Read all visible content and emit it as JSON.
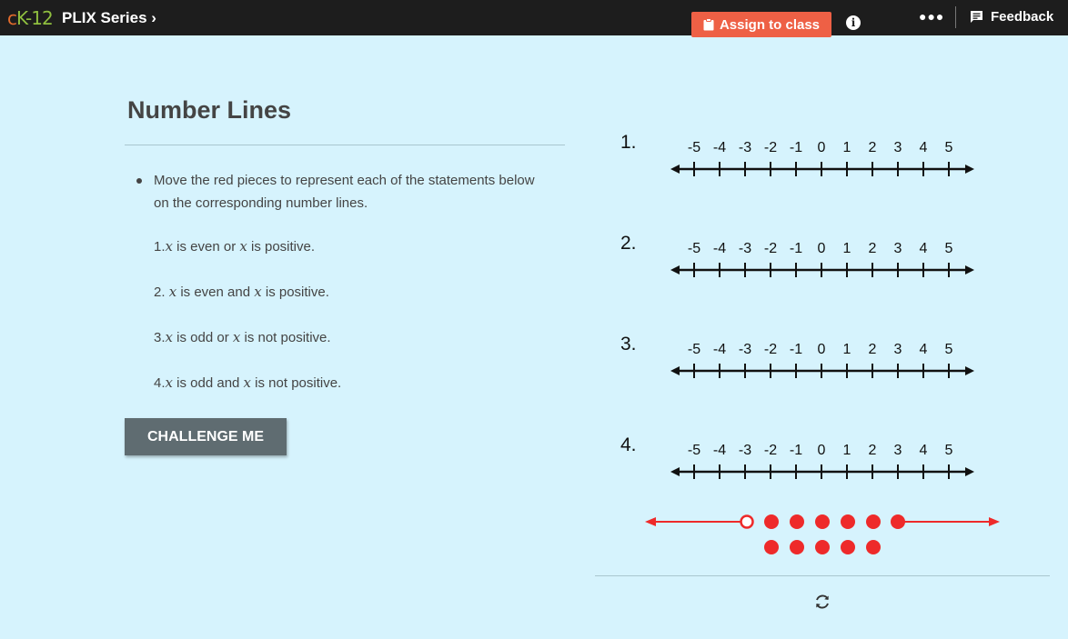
{
  "header": {
    "logo_c": "c",
    "logo_k": "K-12",
    "series": "PLIX Series",
    "series_chevron": "›",
    "assign": "Assign to class",
    "info": "i",
    "more": "●●●",
    "feedback": "Feedback"
  },
  "content": {
    "title": "Number Lines",
    "instruction": "Move the red pieces to represent each of the statements below on the corresponding number lines.",
    "statements": [
      {
        "num": "1.",
        "parts": [
          "",
          "x",
          " is even or ",
          "x",
          " is positive."
        ]
      },
      {
        "num": "2. ",
        "parts": [
          "",
          "x",
          " is even and ",
          "x",
          " is positive."
        ]
      },
      {
        "num": "3.",
        "parts": [
          "",
          "x",
          " is odd or ",
          "x",
          " is not positive."
        ]
      },
      {
        "num": "4.",
        "parts": [
          "",
          "x",
          " is odd and ",
          "x",
          " is not positive."
        ]
      }
    ],
    "challenge": "CHALLENGE ME"
  },
  "number_lines": {
    "labels": [
      "1.",
      "2.",
      "3.",
      "4."
    ],
    "ticks": [
      "-5",
      "-4",
      "-3",
      "-2",
      "-1",
      "0",
      "1",
      "2",
      "3",
      "4",
      "5"
    ]
  },
  "pieces": {
    "color": "#ee2a2a",
    "ray": {
      "open_endpoint": "open-circle",
      "closed_endpoint": "filled-circle"
    },
    "row1_dots": 5,
    "row2_dots": 5
  },
  "colors": {
    "background": "#d6f3fd",
    "topbar": "#1d1d1d",
    "assign": "#ee6045",
    "challenge": "#5f6c71"
  }
}
